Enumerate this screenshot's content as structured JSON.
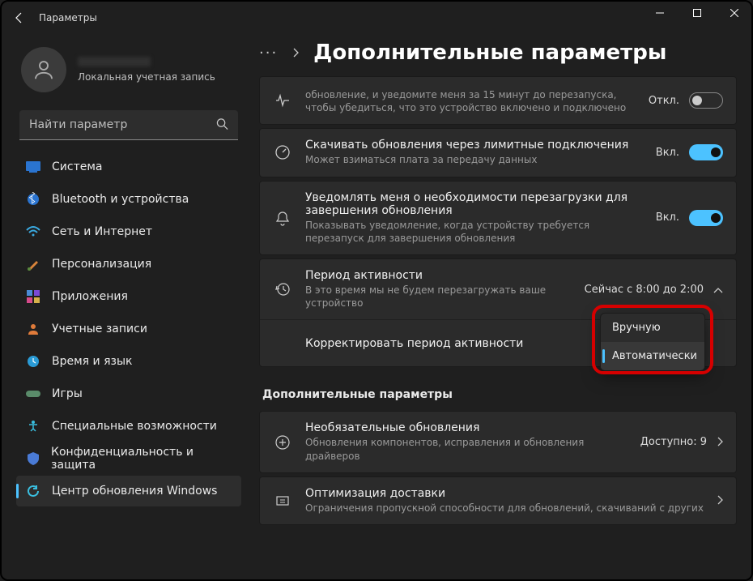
{
  "window": {
    "title": "Параметры"
  },
  "profile": {
    "subtitle": "Локальная учетная запись"
  },
  "search": {
    "placeholder": "Найти параметр"
  },
  "nav": [
    {
      "label": "Система"
    },
    {
      "label": "Bluetooth и устройства"
    },
    {
      "label": "Сеть и Интернет"
    },
    {
      "label": "Персонализация"
    },
    {
      "label": "Приложения"
    },
    {
      "label": "Учетные записи"
    },
    {
      "label": "Время и язык"
    },
    {
      "label": "Игры"
    },
    {
      "label": "Специальные возможности"
    },
    {
      "label": "Конфиденциальность и защита"
    },
    {
      "label": "Центр обновления Windows"
    }
  ],
  "breadcrumb": {
    "dots": "···",
    "title": "Дополнительные параметры"
  },
  "rows": {
    "restart": {
      "desc": "обновление, и уведомите меня за 15 минут до перезапуска, чтобы убедиться, что это устройство включено и подключено",
      "state": "Откл."
    },
    "metered": {
      "title": "Скачивать обновления через лимитные подключения",
      "desc": "Может взиматься плата за передачу данных",
      "state": "Вкл."
    },
    "notify": {
      "title": "Уведомлять меня о необходимости перезагрузки для завершения обновления",
      "desc": "Показывать уведомление, когда устройству требуется перезапуск для завершения обновления",
      "state": "Вкл."
    },
    "active": {
      "title": "Период активности",
      "desc": "В это время мы не будем перезагружать ваше устройство",
      "value": "Сейчас с 8:00 до 2:00"
    },
    "adjust": {
      "title": "Корректировать период активности"
    }
  },
  "dropdown": {
    "option_manual": "Вручную",
    "option_auto": "Автоматически"
  },
  "section": {
    "more": "Дополнительные параметры"
  },
  "optional": {
    "title": "Необязательные обновления",
    "desc": "Обновления компонентов, исправления и обновления драйверов",
    "value": "Доступно: 9"
  },
  "delivery": {
    "title": "Оптимизация доставки",
    "desc": "Ограничения пропускной способности для обновлений, скачиваний с других"
  }
}
